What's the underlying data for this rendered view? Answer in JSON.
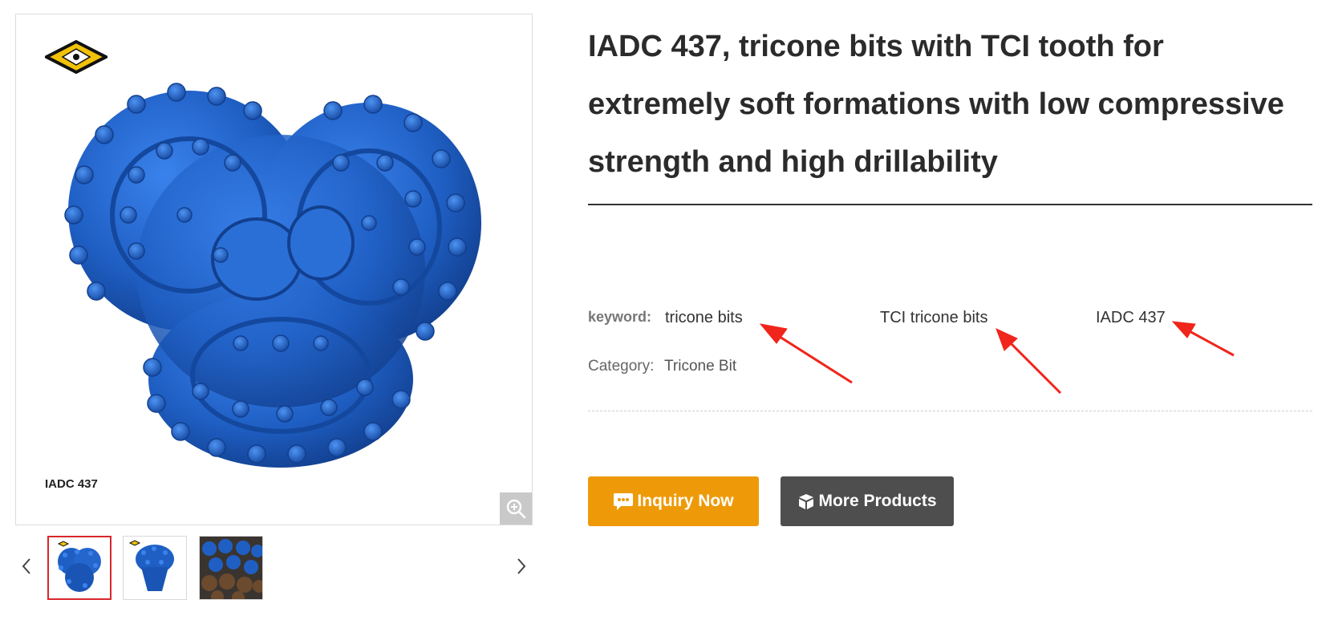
{
  "gallery": {
    "caption": "IADC 437",
    "logo_icon": "diamond-logo-icon",
    "zoom_icon": "zoom-in-icon",
    "prev_icon": "chevron-left-icon",
    "next_icon": "chevron-right-icon",
    "thumbnails": [
      {
        "name": "tricone-bit-front",
        "active": true
      },
      {
        "name": "tricone-bit-side",
        "active": false
      },
      {
        "name": "tricone-bits-pile",
        "active": false
      }
    ]
  },
  "product": {
    "title": "IADC 437, tricone bits with TCI tooth for extremely soft formations with low compressive strength and high drillability",
    "keyword_label": "keyword:",
    "keywords": [
      "tricone bits",
      "TCI tricone bits",
      "IADC 437"
    ],
    "category_label": "Category:",
    "category_value": "Tricone Bit"
  },
  "actions": {
    "inquiry_label": "Inquiry Now",
    "inquiry_icon": "chat-bubble-icon",
    "more_label": "More Products",
    "more_icon": "box-icon"
  },
  "colors": {
    "inquiry": "#ee9a08",
    "more": "#4e4e4e",
    "product_blue": "#1f5fc4",
    "annotation_red": "#f0251b",
    "thumb_active_border": "#d9262c"
  }
}
